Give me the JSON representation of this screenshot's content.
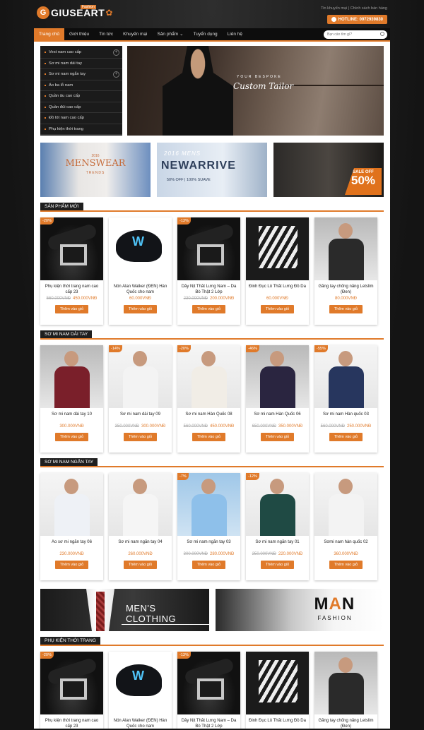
{
  "header": {
    "logo_text": "GIUSEART",
    "logo_tag": "Fashion",
    "top_links": "Tin khuyến mại | Chính sách bán hàng",
    "hotline": "HOTLINE: 0972939830"
  },
  "nav": {
    "items": [
      "Trang chủ",
      "Giới thiệu",
      "Tin tức",
      "Khuyến mại",
      "Sản phẩm",
      "Tuyển dụng",
      "Liên hệ"
    ],
    "search_placeholder": "Bạn cần tìm gì?"
  },
  "side_menu": [
    "Vest nam cao cấp",
    "Sơ mi nam dài tay",
    "Sơ mi nam ngắn tay",
    "Áo ba lỗ nam",
    "Quần âu cao cấp",
    "Quần đùi cao cấp",
    "Đồ lót nam cao cấp",
    "Phụ kiện thời trang"
  ],
  "slider": {
    "line1": "YOUR BESPOKE",
    "line2": "Custom Tailor"
  },
  "banners": {
    "b1_small": "2016",
    "b1_big": "MENSWEAR",
    "b1_sub": "TRENDS",
    "b2_top": "2016 MENS",
    "b2_big": "NEWARRIVE",
    "b2_sub": "50% OFF | 100% SUAVE",
    "b3_sale": "SALE OFF",
    "b3_pct": "50%"
  },
  "add_to_cart": "Thêm vào giỏ",
  "sections": [
    {
      "title": "SẢN PHẨM MỚI",
      "products": [
        {
          "badge": "-20%",
          "name": "Phụ kiện thời trang nam cao cấp 23",
          "old": "560.000VNĐ",
          "price": "450.000VNĐ"
        },
        {
          "badge": "",
          "name": "Nón Alan Walker (ĐEN) Hàn Quốc cho nam",
          "old": "",
          "price": "60.000VNĐ"
        },
        {
          "badge": "-13%",
          "name": "Dây Nịt Thắt Lưng Nam – Da Bò Thật 2 Lớp",
          "old": "230.000VNĐ",
          "price": "200.000VNĐ"
        },
        {
          "badge": "",
          "name": "Đinh Đục Lỗ Thắt Lưng Đồ Da",
          "old": "",
          "price": "60.000VNĐ"
        },
        {
          "badge": "",
          "name": "Găng tay chống nắng Letslim (Đen)",
          "old": "",
          "price": "80.000VNĐ"
        }
      ]
    },
    {
      "title": "SƠ MI NAM DÀI TAY",
      "products": [
        {
          "badge": "",
          "name": "Sơ mi nam dài tay 10",
          "old": "",
          "price": "300.000VNĐ"
        },
        {
          "badge": "-14%",
          "name": "Sơ mi nam dài tay 09",
          "old": "350.000VNĐ",
          "price": "300.000VNĐ"
        },
        {
          "badge": "-20%",
          "name": "Sơ mi nam Hàn Quốc 08",
          "old": "560.000VNĐ",
          "price": "450.000VNĐ"
        },
        {
          "badge": "-46%",
          "name": "Sơ mi nam Hàn Quốc 06",
          "old": "650.000VNĐ",
          "price": "350.000VNĐ"
        },
        {
          "badge": "-55%",
          "name": "Sơ mi nam Hàn quốc 03",
          "old": "560.000VNĐ",
          "price": "250.000VNĐ"
        }
      ]
    },
    {
      "title": "SƠ MI NAM NGẮN TAY",
      "products": [
        {
          "badge": "",
          "name": "Áo sơ mi ngắn tay 06",
          "old": "",
          "price": "230.000VNĐ"
        },
        {
          "badge": "",
          "name": "Sơ mi nam ngắn tay 04",
          "old": "",
          "price": "260.000VNĐ"
        },
        {
          "badge": "-7%",
          "name": "Sơ mi nam ngắn tay 03",
          "old": "300.000VNĐ",
          "price": "280.000VNĐ"
        },
        {
          "badge": "-12%",
          "name": "Sơ mi nam ngắn tay 01",
          "old": "250.000VNĐ",
          "price": "220.000VNĐ"
        },
        {
          "badge": "",
          "name": "Sơmi nam hàn quốc 02",
          "old": "",
          "price": "360.000VNĐ"
        }
      ]
    },
    {
      "title": "PHỤ KIỆN THỜI TRANG",
      "products": [
        {
          "badge": "-20%",
          "name": "Phụ kiện thời trang nam cao cấp 23",
          "old": "",
          "price": ""
        },
        {
          "badge": "",
          "name": "Nón Alan Walker (ĐEN) Hàn Quốc cho nam",
          "old": "",
          "price": ""
        },
        {
          "badge": "-13%",
          "name": "Dây Nịt Thắt Lưng Nam – Da Bò Thật 2 Lớp",
          "old": "",
          "price": ""
        },
        {
          "badge": "",
          "name": "Đinh Đục Lỗ Thắt Lưng Đồ Da",
          "old": "",
          "price": ""
        },
        {
          "badge": "",
          "name": "Găng tay chống nắng Letslim (Đen)",
          "old": "",
          "price": ""
        }
      ]
    }
  ],
  "bottom_banners": {
    "left": "MEN'S CLOTHING",
    "right_m": "M",
    "right_a": "A",
    "right_n": "N",
    "right_sub": "FASHION"
  },
  "colors": {
    "accent": "#e07a2a",
    "dark": "#1b1b1b"
  }
}
